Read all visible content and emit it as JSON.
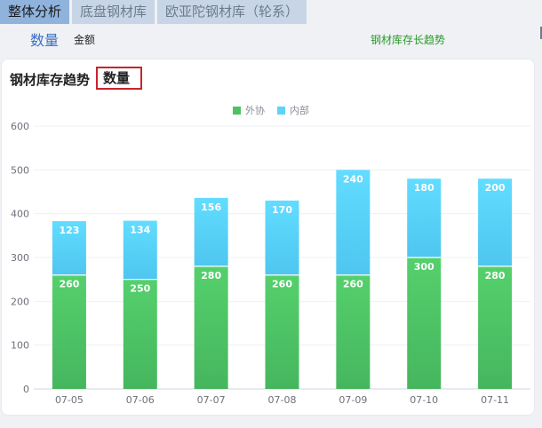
{
  "tabs": [
    {
      "label": "整体分析",
      "active": true
    },
    {
      "label": "底盘钢材库",
      "active": false
    },
    {
      "label": "欧亚陀钢材库（轮系）",
      "active": false
    }
  ],
  "subbar": {
    "quantity": "数量",
    "amount": "金额",
    "trend": "钢材库存长趋势"
  },
  "card": {
    "title": "钢材库存趋势",
    "mode": "数量"
  },
  "colors": {
    "outsourced": "#4cc264",
    "internal": "#5bd4f8",
    "accent": "#c9242c"
  },
  "chart_data": {
    "type": "bar",
    "stacked": true,
    "categories": [
      "07-05",
      "07-06",
      "07-07",
      "07-08",
      "07-09",
      "07-10",
      "07-11"
    ],
    "series": [
      {
        "name": "外协",
        "values": [
          260,
          250,
          280,
          260,
          260,
          300,
          280
        ]
      },
      {
        "name": "内部",
        "values": [
          123,
          134,
          156,
          170,
          240,
          180,
          200
        ]
      }
    ],
    "ylim": [
      0,
      600
    ],
    "yticks": [
      0,
      100,
      200,
      300,
      400,
      500,
      600
    ],
    "grid": true,
    "legend_position": "top-center"
  }
}
